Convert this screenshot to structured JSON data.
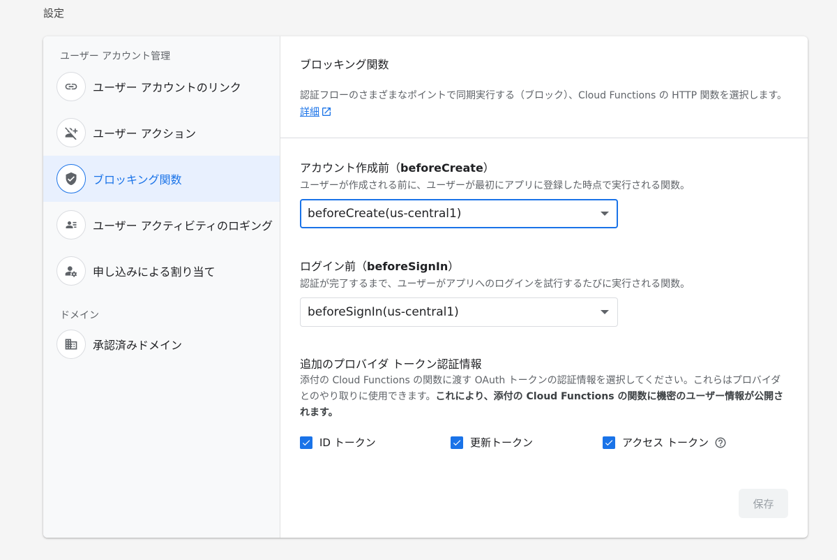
{
  "page": {
    "title": "設定"
  },
  "sidebar": {
    "sections": [
      {
        "heading": "ユーザー アカウント管理",
        "items": [
          {
            "label": "ユーザー アカウントのリンク",
            "icon": "link-icon"
          },
          {
            "label": "ユーザー アクション",
            "icon": "person-off-icon"
          },
          {
            "label": "ブロッキング関数",
            "icon": "shield-check-icon",
            "active": true
          },
          {
            "label": "ユーザー アクティビティのロギング",
            "icon": "contact-card-icon"
          },
          {
            "label": "申し込みによる割り当て",
            "icon": "person-gear-icon"
          }
        ]
      },
      {
        "heading": "ドメイン",
        "items": [
          {
            "label": "承認済みドメイン",
            "icon": "building-icon"
          }
        ]
      }
    ]
  },
  "main": {
    "title": "ブロッキング関数",
    "description": "認証フローのさまざまなポイントで同期実行する（ブロック）、Cloud Functions の HTTP 関数を選択します。",
    "learn_more_link": "詳細",
    "before_create": {
      "title_prefix": "アカウント作成前（",
      "title_code": "beforeCreate",
      "title_suffix": "）",
      "description": "ユーザーが作成される前に、ユーザーが最初にアプリに登録した時点で実行される関数。",
      "selected": "beforeCreate(us-central1)"
    },
    "before_signin": {
      "title_prefix": "ログイン前（",
      "title_code": "beforeSignIn",
      "title_suffix": "）",
      "description": "認証が完了するまで、ユーザーがアプリへのログインを試行するたびに実行される関数。",
      "selected": "beforeSignIn(us-central1)"
    },
    "tokens": {
      "title": "追加のプロバイダ トークン認証情報",
      "description_plain": "添付の Cloud Functions の関数に渡す OAuth トークンの認証情報を選択してください。これらはプロバイダとのやり取りに使用できます。",
      "description_bold": "これにより、添付の Cloud Functions の関数に機密のユーザー情報が公開されます。",
      "options": [
        {
          "label": "ID トークン",
          "checked": true
        },
        {
          "label": "更新トークン",
          "checked": true
        },
        {
          "label": "アクセス トークン",
          "checked": true
        }
      ]
    },
    "save_label": "保存"
  },
  "colors": {
    "accent": "#1a73e8",
    "active_bg": "#e8f0fe",
    "muted_text": "#5f6368"
  }
}
